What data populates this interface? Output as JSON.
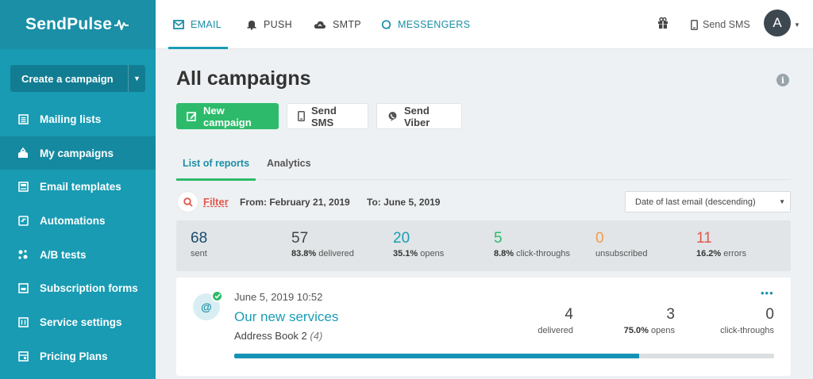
{
  "brand": {
    "name": "SendPulse"
  },
  "sidebar": {
    "create_label": "Create a campaign",
    "items": [
      {
        "label": "Mailing lists",
        "icon": "mailing-list-icon"
      },
      {
        "label": "My campaigns",
        "icon": "campaigns-icon",
        "active": true
      },
      {
        "label": "Email templates",
        "icon": "template-icon"
      },
      {
        "label": "Automations",
        "icon": "automation-icon"
      },
      {
        "label": "A/B tests",
        "icon": "ab-test-icon"
      },
      {
        "label": "Subscription forms",
        "icon": "form-icon"
      },
      {
        "label": "Service settings",
        "icon": "settings-icon"
      },
      {
        "label": "Pricing Plans",
        "icon": "pricing-icon"
      }
    ]
  },
  "topbar": {
    "tabs": [
      {
        "label": "EMAIL",
        "icon": "email-icon",
        "active": true
      },
      {
        "label": "PUSH",
        "icon": "bell-icon"
      },
      {
        "label": "SMTP",
        "icon": "cloud-icon"
      },
      {
        "label": "MESSENGERS",
        "icon": "chat-icon"
      }
    ],
    "send_sms": "Send SMS",
    "avatar_letter": "A"
  },
  "main": {
    "title": "All campaigns",
    "buttons": {
      "new_campaign": "New campaign",
      "send_sms": "Send SMS",
      "send_viber": "Send Viber"
    },
    "subtabs": {
      "reports": "List of reports",
      "analytics": "Analytics"
    },
    "filter": {
      "label": "Filter",
      "from": "From: February 21, 2019",
      "to": "To: June 5, 2019",
      "sort": "Date of last email (descending)"
    },
    "stats": {
      "sent": {
        "num": "68",
        "lbl": "sent"
      },
      "delivered": {
        "num": "57",
        "pct": "83.8%",
        "lbl": "delivered"
      },
      "opens": {
        "num": "20",
        "pct": "35.1%",
        "lbl": "opens"
      },
      "clicks": {
        "num": "5",
        "pct": "8.8%",
        "lbl": "click-throughs"
      },
      "unsub": {
        "num": "0",
        "lbl": "unsubscribed"
      },
      "errors": {
        "num": "11",
        "pct": "16.2%",
        "lbl": "errors"
      }
    },
    "campaign": {
      "date": "June 5, 2019 10:52",
      "title": "Our new services",
      "book": "Address Book 2",
      "book_count": "(4)",
      "delivered": {
        "num": "4",
        "lbl": "delivered"
      },
      "opens": {
        "num": "3",
        "pct": "75.0%",
        "lbl": "opens"
      },
      "clicks": {
        "num": "0",
        "lbl": "click-throughs"
      },
      "progress": 0.75
    }
  },
  "colors": {
    "sidebar": "#189bb3",
    "accent": "#1a8fa6",
    "green": "#2dbb6b",
    "red": "#e2574c",
    "orange": "#f39a4c"
  }
}
